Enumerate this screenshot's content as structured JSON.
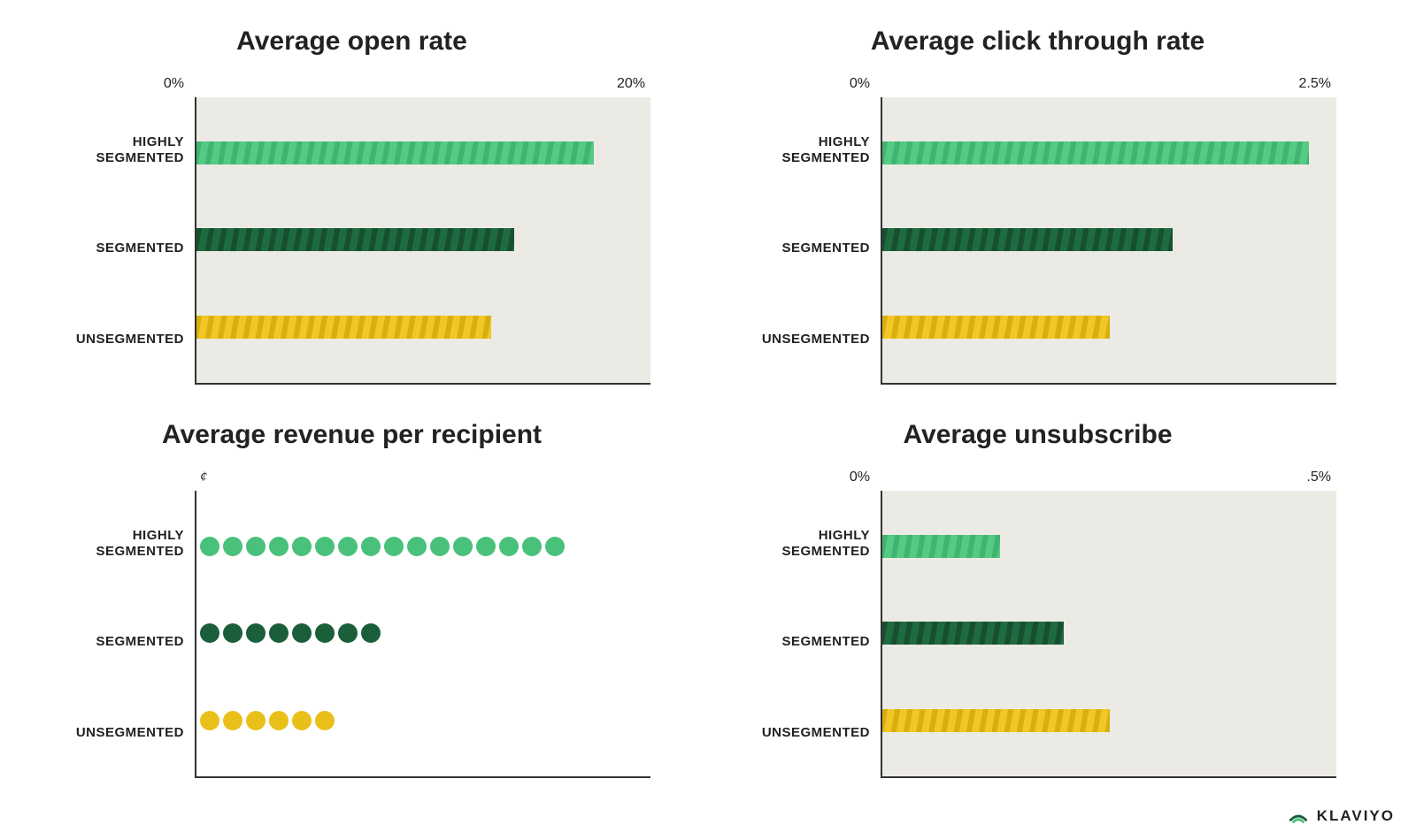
{
  "brand": "KLAVIYO",
  "categories": [
    {
      "id": "highly",
      "label_html": "HIGHLY\nSEGMENTED"
    },
    {
      "id": "segmented",
      "label_html": "SEGMENTED"
    },
    {
      "id": "unsegmented",
      "label_html": "UNSEGMENTED"
    }
  ],
  "charts": {
    "open_rate": {
      "title": "Average open rate",
      "axis_min_label": "0%",
      "axis_max_label": "20%"
    },
    "click_rate": {
      "title": "Average click through rate",
      "axis_min_label": "0%",
      "axis_max_label": "2.5%"
    },
    "revenue": {
      "title": "Average revenue per recipient",
      "axis_unit_label": "¢"
    },
    "unsubscribe": {
      "title": "Average unsubscribe",
      "axis_min_label": "0%",
      "axis_max_label": ".5%"
    }
  },
  "chart_data": [
    {
      "type": "bar",
      "title": "Average open rate",
      "categories": [
        "HIGHLY SEGMENTED",
        "SEGMENTED",
        "UNSEGMENTED"
      ],
      "values": [
        17.5,
        14,
        13
      ],
      "xlabel": "",
      "ylabel": "",
      "xlim": [
        0,
        20
      ],
      "axis_tick_labels": [
        "0%",
        "20%"
      ]
    },
    {
      "type": "bar",
      "title": "Average click through rate",
      "categories": [
        "HIGHLY SEGMENTED",
        "SEGMENTED",
        "UNSEGMENTED"
      ],
      "values": [
        2.35,
        1.6,
        1.25
      ],
      "xlabel": "",
      "ylabel": "",
      "xlim": [
        0,
        2.5
      ],
      "axis_tick_labels": [
        "0%",
        "2.5%"
      ]
    },
    {
      "type": "bar",
      "title": "Average revenue per recipient",
      "unit": "¢",
      "categories": [
        "HIGHLY SEGMENTED",
        "SEGMENTED",
        "UNSEGMENTED"
      ],
      "values": [
        16,
        8,
        6
      ],
      "xlabel": "",
      "ylabel": ""
    },
    {
      "type": "bar",
      "title": "Average unsubscribe",
      "categories": [
        "HIGHLY SEGMENTED",
        "SEGMENTED",
        "UNSEGMENTED"
      ],
      "values": [
        0.13,
        0.2,
        0.25
      ],
      "xlabel": "",
      "ylabel": "",
      "xlim": [
        0,
        0.5
      ],
      "axis_tick_labels": [
        "0%",
        ".5%"
      ]
    }
  ]
}
